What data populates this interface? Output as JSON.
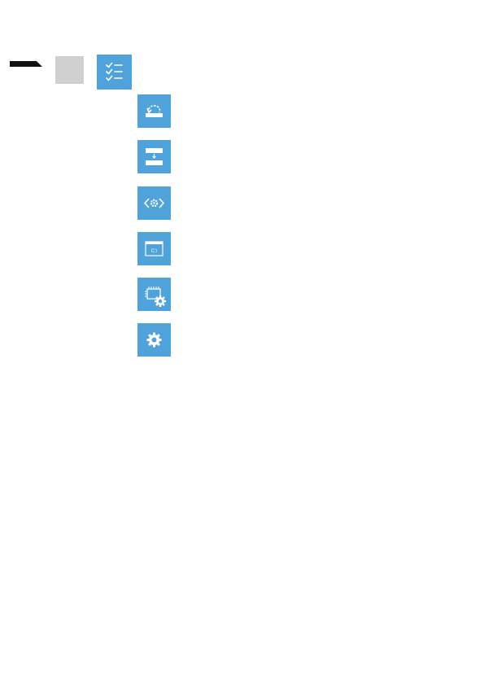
{
  "colors": {
    "tile_blue": "#4fa3da",
    "step_gray": "#cfcfcf",
    "marker": "#111111"
  },
  "header": {
    "step_icon": "step-box-icon",
    "main_icon": "troubleshoot-checklist-icon"
  },
  "options": [
    {
      "icon": "system-restore-icon"
    },
    {
      "icon": "system-image-recovery-icon"
    },
    {
      "icon": "startup-repair-icon"
    },
    {
      "icon": "command-prompt-icon",
      "glyph_text": "C:\\"
    },
    {
      "icon": "uefi-firmware-settings-icon"
    },
    {
      "icon": "startup-settings-icon"
    }
  ]
}
